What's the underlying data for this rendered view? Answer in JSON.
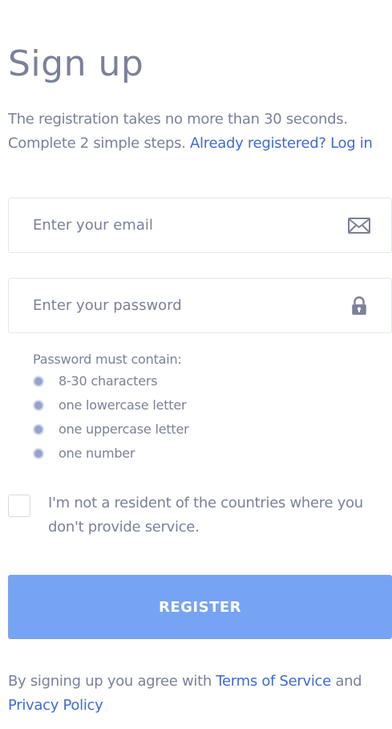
{
  "header": {
    "title": "Sign up"
  },
  "intro": {
    "line1": "The registration takes no more than 30 seconds.",
    "line2_text": "Complete 2 simple steps. ",
    "login_link": "Already registered? Log in"
  },
  "form": {
    "email": {
      "placeholder": "Enter your email",
      "value": "",
      "icon": "envelope-icon"
    },
    "password": {
      "placeholder": "Enter your password",
      "value": "",
      "icon": "lock-icon"
    }
  },
  "password_rules": {
    "title": "Password must contain:",
    "items": [
      "8-30 characters",
      "one lowercase letter",
      "one uppercase letter",
      "one number"
    ]
  },
  "residency": {
    "checked": false,
    "label": "I'm not a resident of the countries where you don't provide service."
  },
  "actions": {
    "register_label": "REGISTER"
  },
  "footer": {
    "prefix": "By signing up you agree with ",
    "terms_link": "Terms of Service",
    "conjunction": " and",
    "privacy_link": "Privacy Policy"
  },
  "colors": {
    "text": "#7b8199",
    "link": "#3f6bd6",
    "button": "#77a3f4",
    "rule_dot": "#97a3cb",
    "border": "#e3e6ee"
  }
}
